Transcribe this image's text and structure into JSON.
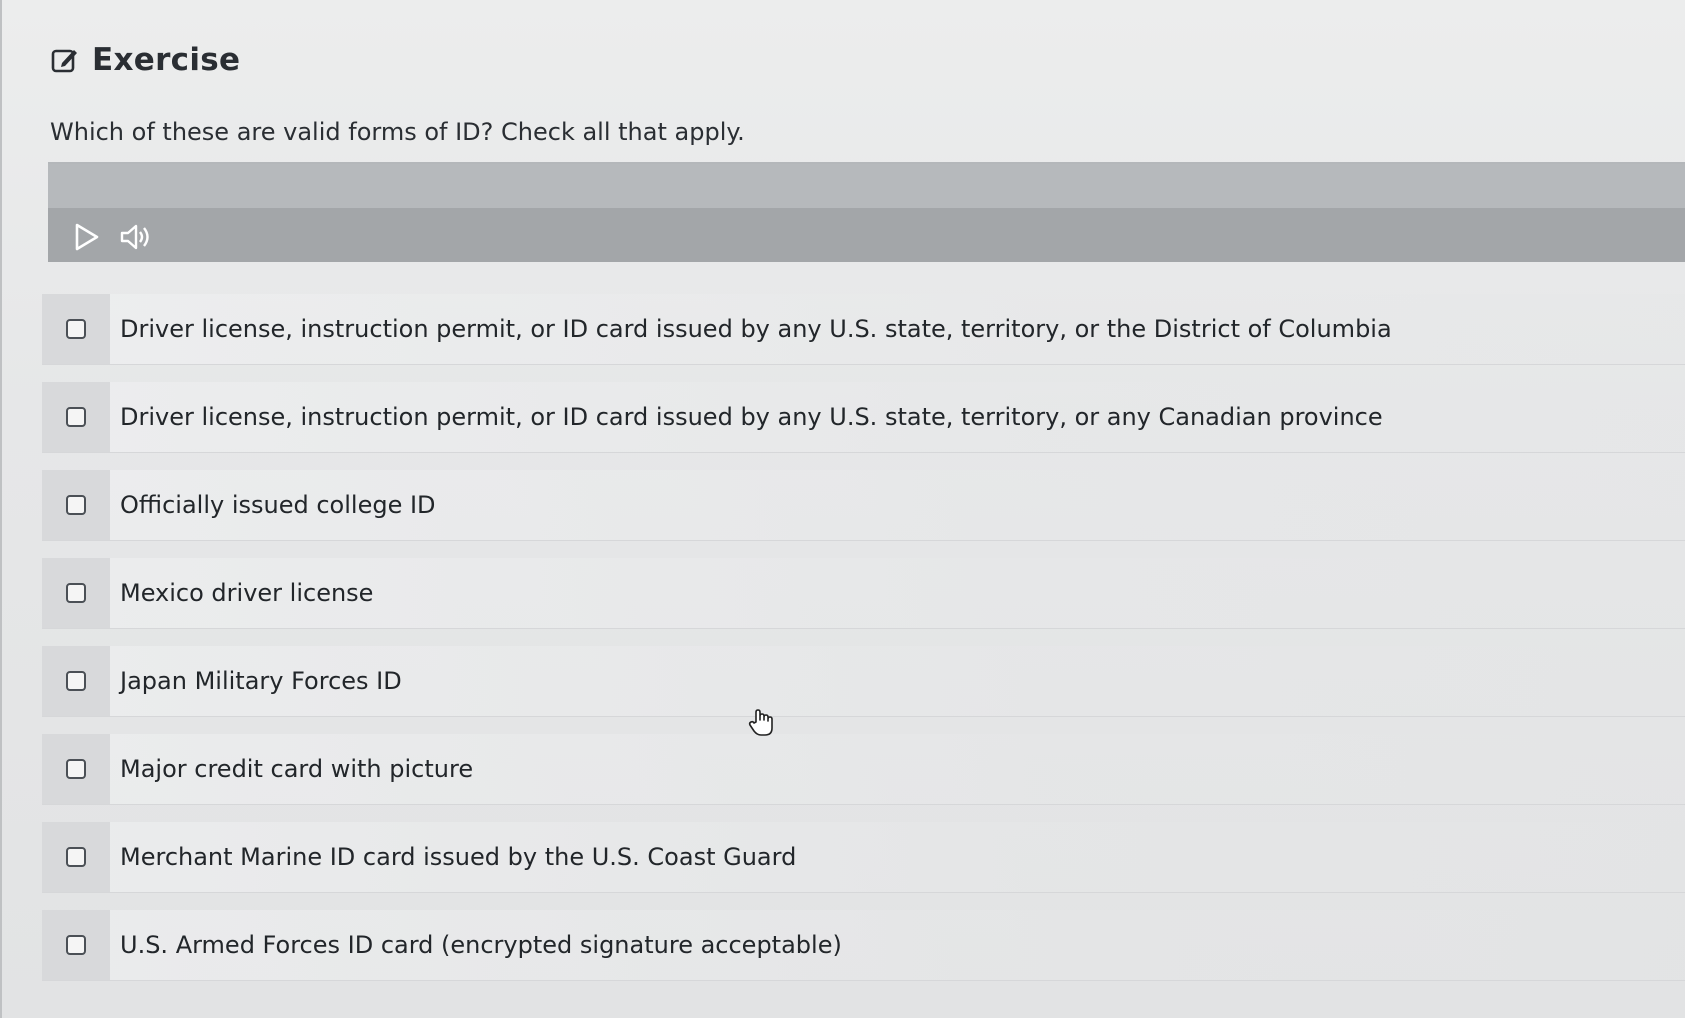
{
  "header": {
    "title": "Exercise",
    "icon": "edit-icon"
  },
  "question": "Which of these are valid forms of ID? Check all that apply.",
  "media_player": {
    "play_icon": "play-icon",
    "volume_icon": "volume-icon"
  },
  "options": [
    {
      "label": "Driver license, instruction permit, or ID card issued by any U.S. state, territory, or the District of Columbia",
      "checked": false
    },
    {
      "label": "Driver license, instruction permit, or ID card issued by any U.S. state, territory, or any Canadian province",
      "checked": false
    },
    {
      "label": "Officially issued college ID",
      "checked": false
    },
    {
      "label": "Mexico driver license",
      "checked": false
    },
    {
      "label": "Japan Military Forces ID",
      "checked": false
    },
    {
      "label": "Major credit card with picture",
      "checked": false
    },
    {
      "label": "Merchant Marine ID card issued by the U.S. Coast Guard",
      "checked": false
    },
    {
      "label": "U.S. Armed Forces ID card (encrypted signature acceptable)",
      "checked": false
    }
  ],
  "colors": {
    "background": "#e7e8e9",
    "player_bar": "#a3a6a9",
    "text": "#22262a"
  }
}
